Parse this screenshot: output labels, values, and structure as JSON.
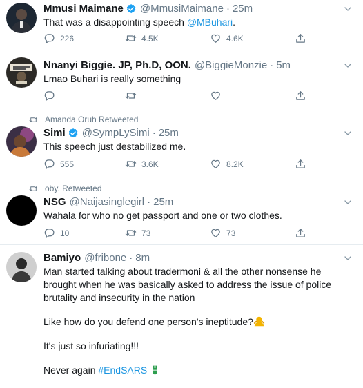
{
  "tweets": [
    {
      "retweeted_by": "",
      "name": "Mmusi Maimane",
      "verified": true,
      "handle": "@MmusiMaimane",
      "time": "25m",
      "text_before": "That was a disappointing speech ",
      "mention": "@MBuhari",
      "text_after": ".",
      "replies": "226",
      "retweets": "4.5K",
      "likes": "4.6K"
    },
    {
      "retweeted_by": "",
      "name": "Nnanyi Biggie. JP, Ph.D, OON.",
      "verified": false,
      "handle": "@BiggieMonzie",
      "time": "5m",
      "text": "Lmao Buhari is really something",
      "replies": "",
      "retweets": "",
      "likes": ""
    },
    {
      "retweeted_by": "Amanda Oruh Retweeted",
      "name": "Simi",
      "verified": true,
      "handle": "@SympLySimi",
      "time": "25m",
      "text": "This speech just destabilized me.",
      "replies": "555",
      "retweets": "3.6K",
      "likes": "8.2K"
    },
    {
      "retweeted_by": "oby. Retweeted",
      "name": "NSG",
      "verified": false,
      "handle": "@Naijasinglegirl",
      "time": "25m",
      "text": "Wahala for who no get passport and one or two clothes.",
      "replies": "10",
      "retweets": "73",
      "likes": "73"
    },
    {
      "retweeted_by": "",
      "name": "Bamiyo",
      "verified": false,
      "handle": "@fribone",
      "time": "8m",
      "paragraphs": [
        "Man started talking about tradermoni & all the other nonsense he brought when he was basically asked to address the issue of police brutality and insecurity in the nation",
        "Like how do you defend one person's ineptitude?",
        "It's just so infuriating!!!"
      ],
      "last_text": "Never again ",
      "hashtag": "#EndSARS"
    }
  ],
  "dot": "·",
  "colors": {
    "link": "#1b95e0",
    "secondary": "#657786",
    "divider": "#e6ecf0"
  },
  "icons": [
    "reply-icon",
    "retweet-icon",
    "like-icon",
    "share-icon",
    "caret-down-icon",
    "verified-badge-icon"
  ]
}
